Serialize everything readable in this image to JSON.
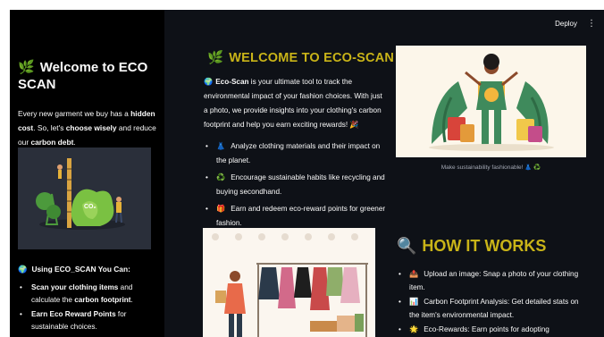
{
  "sidebar": {
    "title_icon": "seedling-icon",
    "title": "Welcome to ECO SCAN",
    "intro_1": "Every new garment we buy has a ",
    "intro_b1": "hidden cost",
    "intro_2": ". So, let's ",
    "intro_b2": "choose wisely",
    "intro_3": " and reduce our ",
    "intro_b3": "carbon debt",
    "intro_4": ".",
    "image_label": "CO₂",
    "sub_title": "Using ECO_SCAN You Can:",
    "items": [
      {
        "b": "Scan your clothing items",
        "t1": " and calculate the ",
        "b2": "carbon footprint",
        "t2": "."
      },
      {
        "b": "Earn Eco Reward Points",
        "t1": " for sustainable choices.",
        "b2": "",
        "t2": ""
      }
    ]
  },
  "header": {
    "deploy": "Deploy",
    "menu": "⋮"
  },
  "welcome": {
    "title": "WELCOME TO ECO-SCAN",
    "brand": "Eco-Scan",
    "text": " is your ultimate tool to track the environmental impact of your fashion choices. With just a photo, we provide insights into your clothing's carbon footprint and help you earn exciting rewards! 🎉",
    "features": [
      {
        "icon": "👗",
        "text": "Analyze clothing materials and their impact on the planet."
      },
      {
        "icon": "♻️",
        "text": "Encourage sustainable habits like recycling and buying secondhand."
      },
      {
        "icon": "🎁",
        "text": "Earn and redeem eco-reward points for greener fashion."
      }
    ]
  },
  "hero": {
    "caption": "Make sustainability fashionable! 👗 ♻️"
  },
  "how": {
    "title": "HOW IT WORKS",
    "steps": [
      {
        "icon": "📤",
        "text": "Upload an image: Snap a photo of your clothing item."
      },
      {
        "icon": "📊",
        "text": "Carbon Footprint Analysis: Get detailed stats on the item's environmental impact."
      },
      {
        "icon": "🌟",
        "text": "Eco-Rewards: Earn points for adopting"
      }
    ]
  },
  "colors": {
    "accent_yellow": "#c9b418",
    "sidebar_bg": "#000000",
    "main_bg": "#0e1117"
  }
}
